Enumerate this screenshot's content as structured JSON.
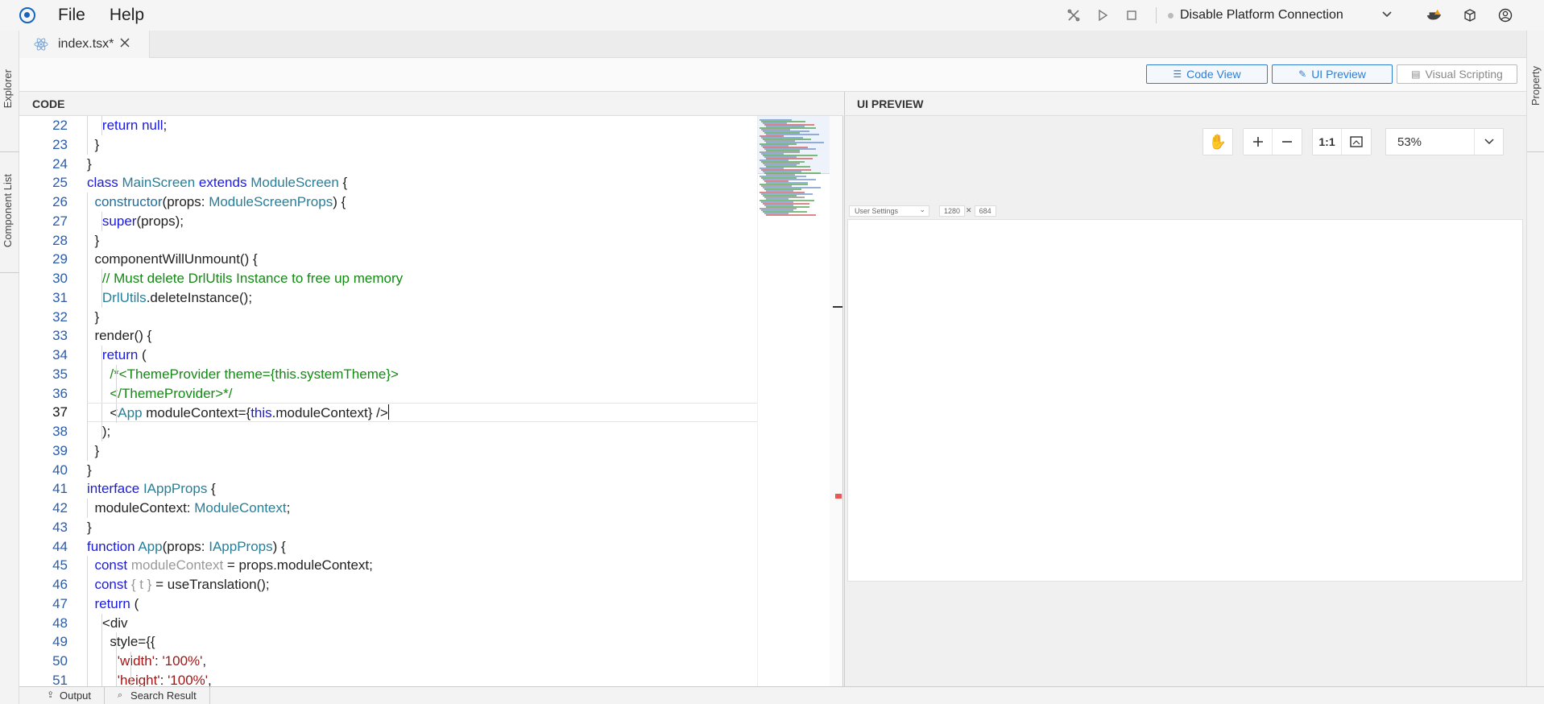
{
  "menubar": {
    "file_label": "File",
    "help_label": "Help"
  },
  "toolbar": {
    "connection_label": "Disable Platform Connection"
  },
  "left_rail": {
    "explorer_label": "Explorer",
    "component_list_label": "Component List"
  },
  "right_rail": {
    "property_label": "Property"
  },
  "editor_tab": {
    "filename": "index.tsx*"
  },
  "view_buttons": {
    "code_view": "Code View",
    "ui_preview": "UI Preview",
    "visual_scripting": "Visual Scripting"
  },
  "code_panel": {
    "header": "CODE",
    "line_numbers": [
      "22",
      "23",
      "24",
      "25",
      "26",
      "27",
      "28",
      "29",
      "30",
      "31",
      "32",
      "33",
      "34",
      "35",
      "36",
      "37",
      "38",
      "39",
      "40",
      "41",
      "42",
      "43",
      "44",
      "45",
      "46",
      "47",
      "48",
      "49",
      "50",
      "51"
    ],
    "current_line": "37"
  },
  "preview_panel": {
    "header": "UI PREVIEW",
    "zoom_ratio_label": "1:1",
    "zoom_value": "53%",
    "device_name": "User Settings",
    "width": "1280",
    "height": "684"
  },
  "bottom_tabs": {
    "output": "Output",
    "search_result": "Search Result"
  },
  "colors": {
    "accent": "#2f7dd1",
    "keyword": "#1a1ae0",
    "type": "#267f99",
    "comment": "#128a12",
    "string": "#a31515"
  }
}
